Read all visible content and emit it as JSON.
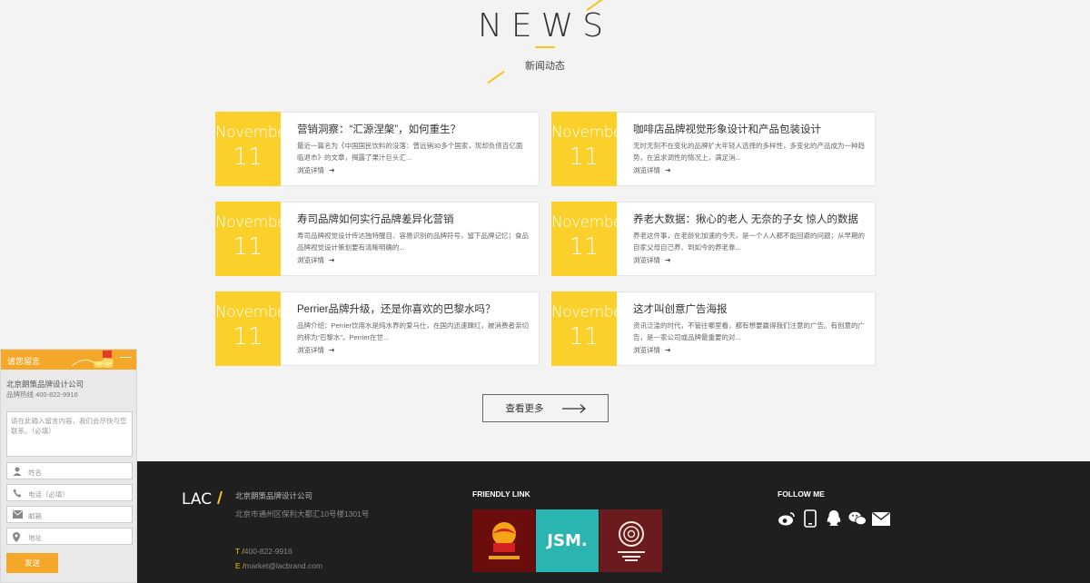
{
  "news_header": {
    "title": "NEWS",
    "subtitle": "新闻动态"
  },
  "colors": {
    "accent": "#fcd02a",
    "footer_bg": "#1f1f1f",
    "widget_orange": "#f4a728"
  },
  "news": [
    {
      "month": "November",
      "day": "11",
      "title": "营销洞察：“汇源涅槃”，如何重生？",
      "excerpt": "最近一篇名为《中国国民饮料的没落：曾远销30多个国家，现却负债百亿面临退市》的文章，揭露了果汁巨头汇...",
      "more": "浏览详情"
    },
    {
      "month": "November",
      "day": "11",
      "title": "咖啡店品牌视觉形象设计和产品包装设计",
      "excerpt": "无时无刻不在变化的品牌扩大年轻人选择的多样性，多变化的产品成为一种趋势，在追求调性的情况上，满足消...",
      "more": "浏览详情"
    },
    {
      "month": "November",
      "day": "11",
      "title": "寿司品牌如何实行品牌差异化营销",
      "excerpt": "寿司品牌视觉设计传达独特醒目、容易识别的品牌符号，留下品牌记忆；食品品牌视觉设计策划要有清晰明确的...",
      "more": "浏览详情"
    },
    {
      "month": "November",
      "day": "11",
      "title": "养老大数据：揪心的老人 无奈的子女 惊人的数据",
      "excerpt": "养老这件事，在老龄化加速的今天，是一个人人都不能回避的问题；从早期的自家父母自己养、到如今的养老靠...",
      "more": "浏览详情"
    },
    {
      "month": "November",
      "day": "11",
      "title": "Perrier品牌升级，还是你喜欢的巴黎水吗？",
      "excerpt": "品牌介绍：Perrier饮用水是纯水界的爱马仕，在国内迅速蹿红，被消费者亲切的称为“巴黎水”。Perrier在世...",
      "more": "浏览详情"
    },
    {
      "month": "November",
      "day": "11",
      "title": "这才叫创意广告海报",
      "excerpt": "资讯泛滥的时代，不管往哪里看，都有想要赢得我们注意的广告。有创意的广告，是一家公司或品牌最重要的对...",
      "more": "浏览详情"
    }
  ],
  "more_button": {
    "label": "查看更多",
    "icon": "long-arrow-right-icon"
  },
  "footer": {
    "logo_text": "LAC",
    "company": "北京朗策品牌设计公司",
    "address": "北京市通州区保利大都汇10号楼1301号",
    "phone_prefix": "T /",
    "phone": "400-822-9916",
    "email_prefix": "E /",
    "email": "market@lacbrand.com",
    "friendly_link_title": "FRIENDLY LINK",
    "links": [
      {
        "name": "red-brand-logo",
        "bg": "#6b0d0d"
      },
      {
        "name": "jsm-logo",
        "text": "JSM.",
        "bg": "#2bb5b0"
      },
      {
        "name": "swirl-brand-logo",
        "bg": "#6b1a1e"
      }
    ],
    "follow_title": "FOLLOW ME",
    "social_icons": [
      "weibo-icon",
      "phone-icon",
      "qq-icon",
      "wechat-icon",
      "mail-icon"
    ]
  },
  "message_widget": {
    "title": "请您留言",
    "minimize": "—",
    "company": "北京朗策品牌设计公司",
    "hotline": "品牌热线 400-822-9916",
    "textarea_placeholder": "请在此输入留言内容，我们会尽快与您联系。（必填）",
    "fields": [
      {
        "icon": "user-icon",
        "placeholder": "姓名"
      },
      {
        "icon": "phone-icon",
        "placeholder": "电话（必填）"
      },
      {
        "icon": "mail-icon",
        "placeholder": "邮箱"
      },
      {
        "icon": "location-icon",
        "placeholder": "地址"
      }
    ],
    "send_label": "发送"
  }
}
